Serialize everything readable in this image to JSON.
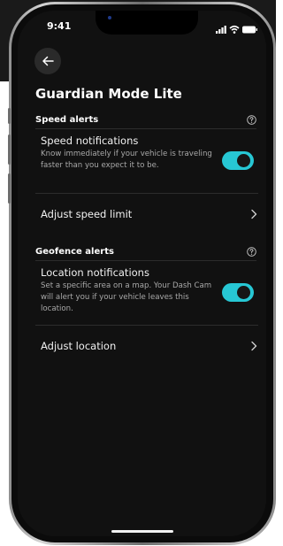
{
  "status_bar": {
    "time": "9:41",
    "icons": [
      "signal-icon",
      "wifi-icon",
      "battery-icon"
    ]
  },
  "header": {
    "back_icon": "arrow-left-icon",
    "title": "Guardian Mode Lite"
  },
  "sections": [
    {
      "label": "Speed alerts",
      "help_icon": "help-circle-icon",
      "toggle_setting": {
        "title": "Speed notifications",
        "description": "Know immediately if your vehicle is traveling faster than you expect it to be.",
        "enabled": true
      },
      "nav_item": {
        "label": "Adjust speed limit",
        "icon": "chevron-right-icon"
      }
    },
    {
      "label": "Geofence alerts",
      "help_icon": "help-circle-icon",
      "toggle_setting": {
        "title": "Location notifications",
        "description": "Set a specific area on a map. Your Dash Cam will alert you if your vehicle leaves this location.",
        "enabled": true
      },
      "nav_item": {
        "label": "Adjust location",
        "icon": "chevron-right-icon"
      }
    }
  ],
  "colors": {
    "accent": "#27c7d4",
    "screen_background": "#111111",
    "text_primary": "#f1f1f1",
    "text_secondary": "#a9a9a9"
  }
}
